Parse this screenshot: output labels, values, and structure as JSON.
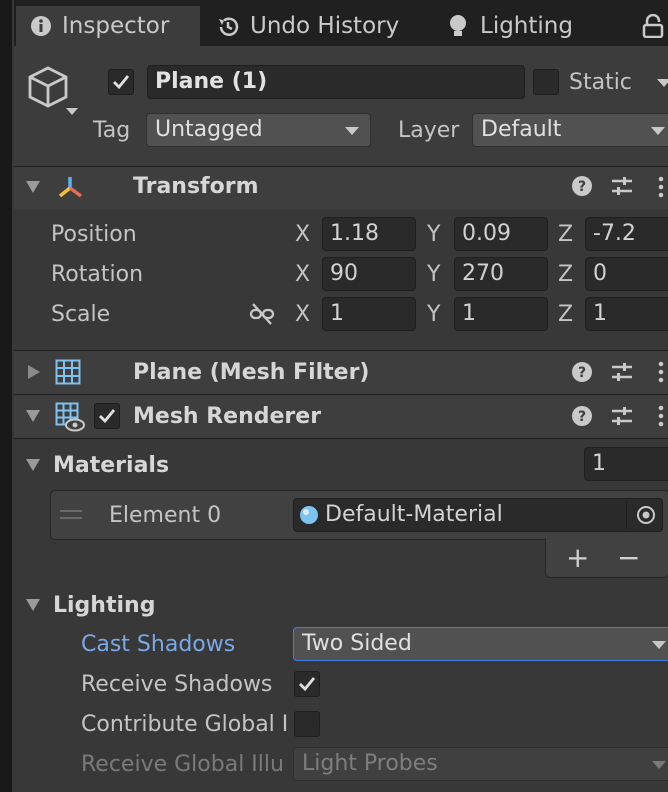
{
  "tabs": [
    {
      "label": "Inspector",
      "icon": "info-icon"
    },
    {
      "label": "Undo History",
      "icon": "history-icon"
    },
    {
      "label": "Lighting",
      "icon": "bulb-icon"
    }
  ],
  "object": {
    "name": "Plane (1)",
    "active": true,
    "static_label": "Static",
    "static": false,
    "tag_label": "Tag",
    "tag_value": "Untagged",
    "layer_label": "Layer",
    "layer_value": "Default"
  },
  "transform": {
    "title": "Transform",
    "rows": [
      {
        "label": "Position",
        "x": "1.18",
        "y": "0.09",
        "z": "-7.2"
      },
      {
        "label": "Rotation",
        "x": "90",
        "y": "270",
        "z": "0"
      },
      {
        "label": "Scale",
        "x": "1",
        "y": "1",
        "z": "1"
      }
    ],
    "axis": {
      "x": "X",
      "y": "Y",
      "z": "Z"
    }
  },
  "mesh_filter": {
    "title": "Plane (Mesh Filter)"
  },
  "mesh_renderer": {
    "title": "Mesh Renderer",
    "enabled": true,
    "materials": {
      "label": "Materials",
      "count": "1",
      "element_label": "Element 0",
      "element_value": "Default-Material",
      "add": "+",
      "remove": "−"
    },
    "lighting": {
      "label": "Lighting",
      "cast_shadows_label": "Cast Shadows",
      "cast_shadows_value": "Two Sided",
      "receive_shadows_label": "Receive Shadows",
      "receive_shadows": true,
      "contribute_gi_label": "Contribute Global I",
      "contribute_gi": false,
      "receive_gi_label": "Receive Global Illu",
      "receive_gi_value": "Light Probes"
    }
  },
  "colors": {
    "background": "#383838",
    "header": "#3e3e3e",
    "field": "#2a2a2a",
    "accent_blue": "#7ba8e8",
    "material_icon": "#7fc3f0"
  }
}
